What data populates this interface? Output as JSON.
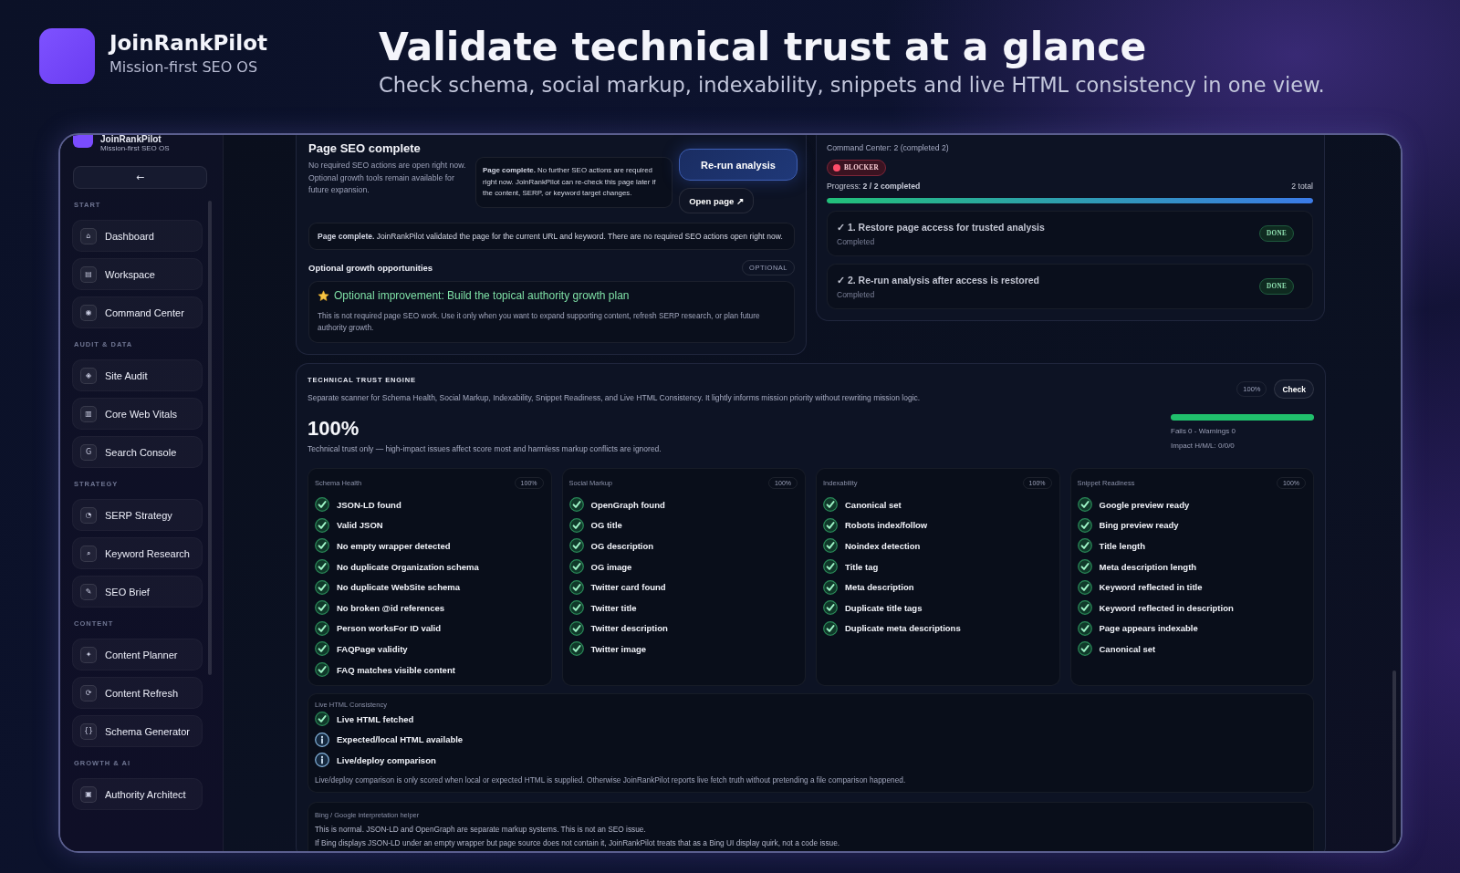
{
  "header": {
    "app_name": "JoinRankPilot",
    "tagline": "Mission-first SEO OS",
    "title": "Validate technical trust at a glance",
    "subtitle": "Check schema, social markup, indexability, snippets and live HTML consistency in one view."
  },
  "sidebar": {
    "brand": {
      "name": "JoinRankPilot",
      "tagline": "Mission-first SEO OS"
    },
    "back_button": "←",
    "sections": [
      {
        "label": "START",
        "items": [
          {
            "icon": "⌂",
            "label": "Dashboard"
          },
          {
            "icon": "▤",
            "label": "Workspace"
          },
          {
            "icon": "◉",
            "label": "Command Center"
          }
        ]
      },
      {
        "label": "AUDIT & DATA",
        "items": [
          {
            "icon": "◈",
            "label": "Site Audit"
          },
          {
            "icon": "▥",
            "label": "Core Web Vitals"
          },
          {
            "icon": "G",
            "label": "Search Console"
          }
        ]
      },
      {
        "label": "STRATEGY",
        "items": [
          {
            "icon": "◔",
            "label": "SERP Strategy"
          },
          {
            "icon": "⌕",
            "label": "Keyword Research"
          },
          {
            "icon": "✎",
            "label": "SEO Brief"
          }
        ]
      },
      {
        "label": "CONTENT",
        "items": [
          {
            "icon": "✦",
            "label": "Content Planner"
          },
          {
            "icon": "⟳",
            "label": "Content Refresh"
          },
          {
            "icon": "{}",
            "label": "Schema Generator"
          }
        ]
      },
      {
        "label": "GROWTH & AI",
        "items": [
          {
            "icon": "▣",
            "label": "Authority Architect"
          }
        ]
      }
    ]
  },
  "page_status": {
    "title": "Page SEO complete",
    "description": "No required SEO actions are open right now. Optional growth tools remain available for future expansion.",
    "note": "**Page complete.** No further SEO actions are required right now. JoinRankPilot can re-check this page later if the content, SERP, or keyword target changes.",
    "buttons": [
      {
        "label": "Re-run analysis",
        "kind": "primary"
      },
      {
        "label": "Open page ↗",
        "kind": "secondary"
      }
    ],
    "banner": "**Page complete.** JoinRankPilot validated the page for the current URL and keyword. There are no required SEO actions open right now.",
    "optional": {
      "heading": "Optional growth opportunities",
      "badge": "OPTIONAL",
      "title": "Optional improvement: Build the topical authority growth plan",
      "description": "This is not required page SEO work. Use it only when you want to expand supporting content, refresh SERP research, or plan future authority growth."
    }
  },
  "command_center": {
    "summary": "Command Center: 2 (completed 2)",
    "badge": "BLOCKER",
    "progress_label": "Progress: **2 / 2 completed**",
    "total": "2 total",
    "level": 1,
    "steps": [
      {
        "title": "✓ 1. Restore page access for trusted analysis",
        "status": "Completed",
        "badge": "DONE"
      },
      {
        "title": "✓ 2. Re-run analysis after access is restored",
        "status": "Completed",
        "badge": "DONE"
      }
    ]
  },
  "trust_engine": {
    "heading": "TECHNICAL TRUST ENGINE",
    "description": "Separate scanner for Schema Health, Social Markup, Indexability, Snippet Readiness, and Live HTML Consistency. It lightly informs mission priority without rewriting mission logic.",
    "score_badge": "100%",
    "check_button": "Check",
    "score": "100%",
    "note": "Technical trust only — high-impact issues affect score most and harmless markup conflicts are ignored.",
    "level": 1,
    "fails_warnings": "Fails 0 - Warnings 0",
    "impact": "Impact H/M/L: 0/0/0",
    "categories": [
      {
        "title": "Schema Health",
        "score": "100%",
        "checks": [
          {
            "label": "JSON-LD found",
            "passed": true
          },
          {
            "label": "Valid JSON",
            "passed": true
          },
          {
            "label": "No empty wrapper detected",
            "passed": true
          },
          {
            "label": "No duplicate Organization schema",
            "passed": true
          },
          {
            "label": "No duplicate WebSite schema",
            "passed": true
          },
          {
            "label": "No broken @id references",
            "passed": true
          },
          {
            "label": "Person worksFor ID valid",
            "passed": true
          },
          {
            "label": "FAQPage validity",
            "passed": true
          },
          {
            "label": "FAQ matches visible content",
            "passed": true
          }
        ]
      },
      {
        "title": "Social Markup",
        "score": "100%",
        "checks": [
          {
            "label": "OpenGraph found",
            "passed": true
          },
          {
            "label": "OG title",
            "passed": true
          },
          {
            "label": "OG description",
            "passed": true
          },
          {
            "label": "OG image",
            "passed": true
          },
          {
            "label": "Twitter card found",
            "passed": true
          },
          {
            "label": "Twitter title",
            "passed": true
          },
          {
            "label": "Twitter description",
            "passed": true
          },
          {
            "label": "Twitter image",
            "passed": true
          }
        ]
      },
      {
        "title": "Indexability",
        "score": "100%",
        "checks": [
          {
            "label": "Canonical set",
            "passed": true
          },
          {
            "label": "Robots index/follow",
            "passed": true
          },
          {
            "label": "Noindex detection",
            "passed": true
          },
          {
            "label": "Title tag",
            "passed": true
          },
          {
            "label": "Meta description",
            "passed": true
          },
          {
            "label": "Duplicate title tags",
            "passed": true
          },
          {
            "label": "Duplicate meta descriptions",
            "passed": true
          }
        ]
      },
      {
        "title": "Snippet Readiness",
        "score": "100%",
        "checks": [
          {
            "label": "Google preview ready",
            "passed": true
          },
          {
            "label": "Bing preview ready",
            "passed": true
          },
          {
            "label": "Title length",
            "passed": true
          },
          {
            "label": "Meta description length",
            "passed": true
          },
          {
            "label": "Keyword reflected in title",
            "passed": true
          },
          {
            "label": "Keyword reflected in description",
            "passed": true
          },
          {
            "label": "Page appears indexable",
            "passed": true
          },
          {
            "label": "Canonical set",
            "passed": true
          }
        ]
      }
    ],
    "live_html": {
      "title": "Live HTML Consistency",
      "checks": [
        {
          "label": "Live HTML fetched",
          "passed": true
        },
        {
          "label": "Expected/local HTML available",
          "passed": false
        },
        {
          "label": "Live/deploy comparison",
          "passed": false
        }
      ],
      "note": "Live/deploy comparison is only scored when local or expected HTML is supplied. Otherwise JoinRankPilot reports live fetch truth without pretending a file comparison happened."
    },
    "helper": {
      "title": "Bing / Google interpretation helper",
      "lines": [
        "This is normal. JSON-LD and OpenGraph are separate markup systems. This is not an SEO issue.",
        "If Bing displays JSON-LD under an empty wrapper but page source does not contain it, JoinRankPilot treats that as a Bing UI display quirk, not a code issue."
      ]
    }
  }
}
